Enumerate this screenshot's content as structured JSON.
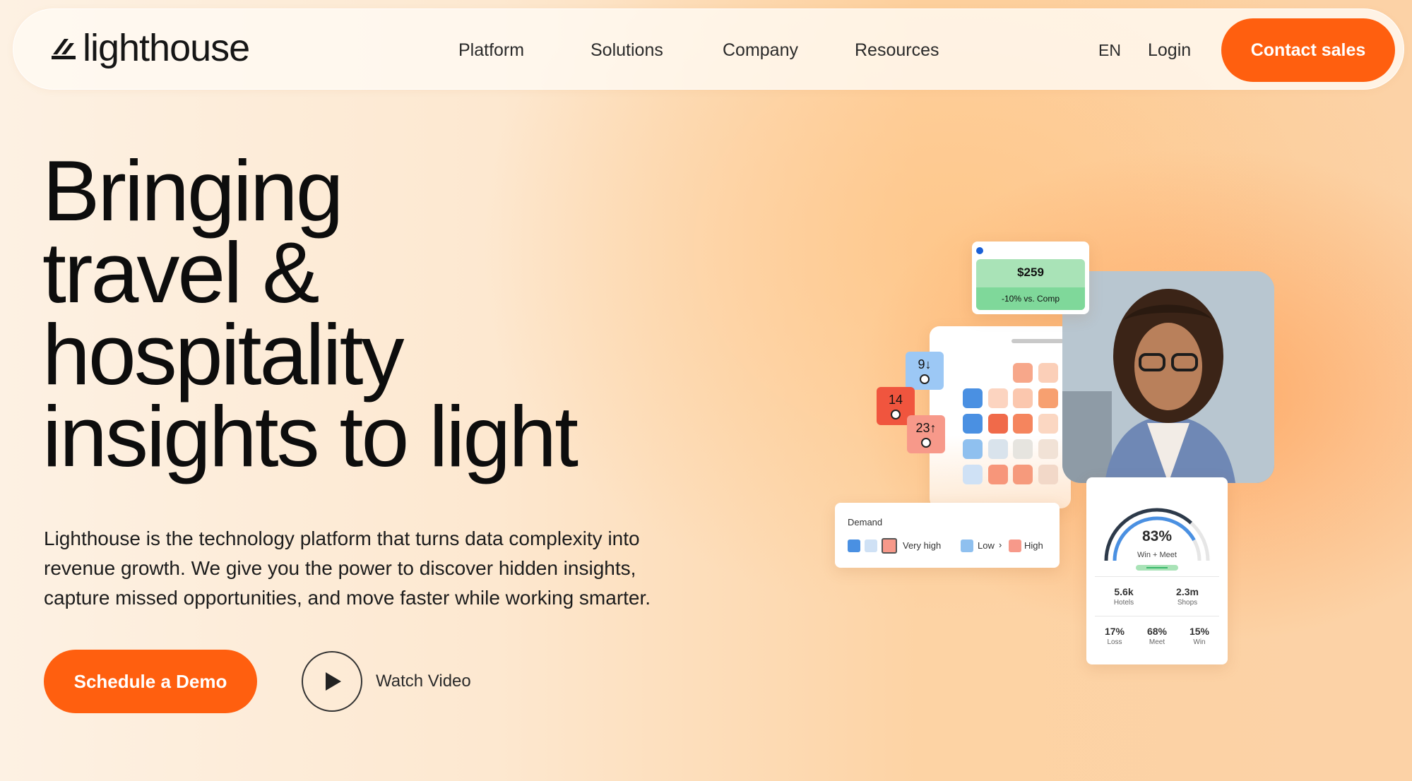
{
  "brand": {
    "name": "lighthouse"
  },
  "nav": {
    "links": [
      "Platform",
      "Solutions",
      "Company",
      "Resources"
    ],
    "language": "EN",
    "login": "Login",
    "contact": "Contact sales"
  },
  "hero": {
    "headline_lines": [
      "Bringing",
      "travel &",
      "hospitality",
      "insights to light"
    ],
    "subtext_lines": [
      "Lighthouse is the technology platform that turns data complexity into",
      "revenue growth. We give you the power to discover hidden insights,",
      "capture missed opportunities, and move faster while working smarter."
    ],
    "primary_cta": "Schedule a Demo",
    "video_cta": "Watch Video"
  },
  "widgets": {
    "price_card": {
      "price": "$259",
      "delta": "-10% vs. Comp"
    },
    "tags": {
      "down": "9↓",
      "mid": "14",
      "up": "23↑"
    },
    "demand": {
      "title": "Demand",
      "very_high": "Very high",
      "low": "Low",
      "arrow": "›",
      "high": "High"
    },
    "gauge": {
      "percent": "83%",
      "percent_value": 83,
      "label": "Win + Meet",
      "stats_top": [
        {
          "value": "5.6k",
          "label": "Hotels"
        },
        {
          "value": "2.3m",
          "label": "Shops"
        }
      ],
      "stats_bottom": [
        {
          "value": "17%",
          "label": "Loss"
        },
        {
          "value": "68%",
          "label": "Meet"
        },
        {
          "value": "15%",
          "label": "Win"
        }
      ]
    }
  },
  "colors": {
    "accent": "#ff5f0f",
    "blue": "#4a90e2",
    "red": "#f0553e",
    "green": "#7fd89a"
  }
}
